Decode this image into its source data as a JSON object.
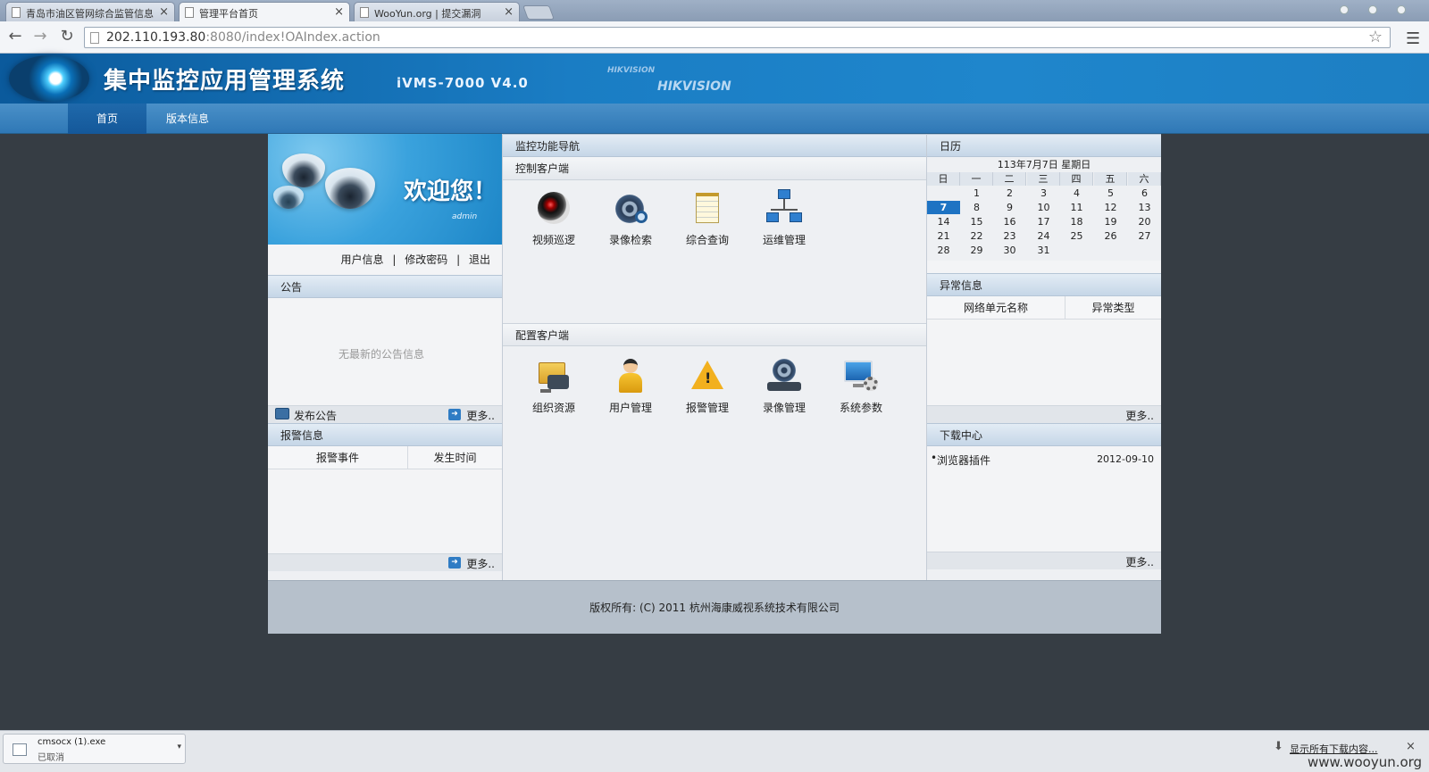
{
  "browser": {
    "tabs": [
      {
        "title": "青岛市油区管网综合监管信息"
      },
      {
        "title": "管理平台首页"
      },
      {
        "title": "WooYun.org | 提交漏洞"
      }
    ],
    "url_host": "202.110.193.80",
    "url_rest": ":8080/index!OAIndex.action",
    "icons": {
      "back": "back-arrow-icon",
      "forward": "forward-arrow-icon",
      "reload": "reload-icon",
      "star": "star-icon",
      "menu": "menu-icon"
    }
  },
  "header": {
    "title": "集中监控应用管理系统",
    "version": "iVMS-7000 V4.0",
    "brand_small": "HIKVISION",
    "brand_big": "HIKVISION"
  },
  "nav": {
    "home": "首页",
    "version_info": "版本信息"
  },
  "welcome": {
    "greeting": "欢迎您！",
    "user": "admin",
    "links": [
      "用户信息",
      "修改密码",
      "退出"
    ],
    "separator": "|"
  },
  "notice": {
    "title": "公告",
    "empty": "无最新的公告信息",
    "publish": "发布公告",
    "more": "更多.."
  },
  "alarm": {
    "title": "报警信息",
    "columns": [
      "报警事件",
      "发生时间"
    ],
    "more": "更多.."
  },
  "monitor_nav": {
    "title": "监控功能导航",
    "control_client": {
      "title": "控制客户端",
      "items": [
        {
          "label": "视频巡逻",
          "icon": "camera-lens-icon"
        },
        {
          "label": "录像检索",
          "icon": "film-reel-search-icon"
        },
        {
          "label": "综合查询",
          "icon": "notepad-icon"
        },
        {
          "label": "运维管理",
          "icon": "network-icon"
        }
      ]
    },
    "config_client": {
      "title": "配置客户端",
      "items": [
        {
          "label": "组织资源",
          "icon": "folder-camera-icon"
        },
        {
          "label": "用户管理",
          "icon": "user-icon"
        },
        {
          "label": "报警管理",
          "icon": "warning-icon"
        },
        {
          "label": "录像管理",
          "icon": "film-reel-icon"
        },
        {
          "label": "系统参数",
          "icon": "monitor-gear-icon"
        }
      ]
    }
  },
  "calendar": {
    "title": "日历",
    "date_line": "113年7月7日  星期日",
    "weekdays": [
      "日",
      "一",
      "二",
      "三",
      "四",
      "五",
      "六"
    ],
    "weeks": [
      [
        "",
        "1",
        "2",
        "3",
        "4",
        "5",
        "6"
      ],
      [
        "7",
        "8",
        "9",
        "10",
        "11",
        "12",
        "13"
      ],
      [
        "14",
        "15",
        "16",
        "17",
        "18",
        "19",
        "20"
      ],
      [
        "21",
        "22",
        "23",
        "24",
        "25",
        "26",
        "27"
      ],
      [
        "28",
        "29",
        "30",
        "31",
        "",
        "",
        ""
      ]
    ],
    "today": "7"
  },
  "exception": {
    "title": "异常信息",
    "columns": [
      "网络单元名称",
      "异常类型"
    ],
    "more": "更多.."
  },
  "downloads_center": {
    "title": "下载中心",
    "items": [
      {
        "name": "浏览器插件",
        "date": "2012-09-10"
      }
    ],
    "more": "更多.."
  },
  "footer": {
    "copyright": "版权所有: (C) 2011 杭州海康威视系统技术有限公司"
  },
  "download_bar": {
    "file_name": "cmsocx (1).exe",
    "status": "已取消",
    "show_all": "显示所有下载内容...",
    "close": "×"
  },
  "watermark": "www.wooyun.org"
}
